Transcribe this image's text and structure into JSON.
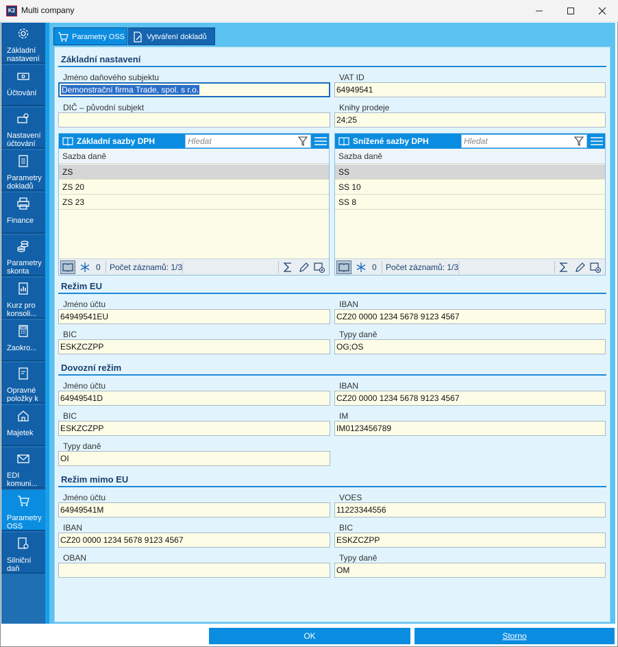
{
  "window": {
    "title": "Multi company",
    "logo_text": "K2"
  },
  "sidebar": {
    "items": [
      {
        "label": "Základní nastavení",
        "icon": "gear-icon"
      },
      {
        "label": "Účtování",
        "icon": "money-icon"
      },
      {
        "label": "Nastavení účtování DPH",
        "icon": "money-settings-icon"
      },
      {
        "label": "Parametry dokladů samovy",
        "icon": "document-icon"
      },
      {
        "label": "Finance",
        "icon": "printer-icon"
      },
      {
        "label": "Parametry skonta",
        "icon": "coins-icon"
      },
      {
        "label": "Kurz pro konsoli...",
        "icon": "chart-document-icon"
      },
      {
        "label": "Zaokro...",
        "icon": "calculator-icon"
      },
      {
        "label": "Opravné položky k pohled",
        "icon": "document-edit-icon"
      },
      {
        "label": "Majetek",
        "icon": "asset-icon"
      },
      {
        "label": "EDI komuni...",
        "icon": "edi-mail-icon"
      },
      {
        "label": "Parametry OSS",
        "icon": "cart-icon"
      },
      {
        "label": "Silniční daň",
        "icon": "document-gear-icon"
      }
    ]
  },
  "tabs": [
    {
      "label": "Parametry OSS",
      "icon": "cart-icon"
    },
    {
      "label": "Vytváření dokladů",
      "icon": "document-create-icon"
    }
  ],
  "basic": {
    "title": "Základní nastavení",
    "tax_subject_label": "Jméno daňového subjektu",
    "tax_subject_value": "Demonstrační firma Trade, spol. s r.o.",
    "vat_id_label": "VAT ID",
    "vat_id_value": "64949541",
    "dic_label": "DIČ – původní subjekt",
    "dic_value": "",
    "sales_books_label": "Knihy prodeje",
    "sales_books_value": "24;25"
  },
  "grid_basic": {
    "title": "Základní sazby DPH",
    "search_placeholder": "Hledat",
    "column": "Sazba daně",
    "rows": [
      "ZS",
      "ZS 20",
      "ZS 23"
    ],
    "zero": "0",
    "count": "Počet záznamů: 1/3"
  },
  "grid_reduced": {
    "title": "Snížené sazby DPH",
    "search_placeholder": "Hledat",
    "column": "Sazba daně",
    "rows": [
      "SS",
      "SS 10",
      "SS 8"
    ],
    "zero": "0",
    "count": "Počet záznamů: 1/3"
  },
  "eu": {
    "title": "Režim EU",
    "account_label": "Jméno účtu",
    "account_value": "64949541EU",
    "iban_label": "IBAN",
    "iban_value": "CZ20 0000 1234 5678 9123 4567",
    "bic_label": "BIC",
    "bic_value": "ESKZCZPP",
    "tax_types_label": "Typy daně",
    "tax_types_value": "OG;OS"
  },
  "import": {
    "title": "Dovozní režim",
    "account_label": "Jméno účtu",
    "account_value": "64949541D",
    "iban_label": "IBAN",
    "iban_value": "CZ20 0000 1234 5678 9123 4567",
    "bic_label": "BIC",
    "bic_value": "ESKZCZPP",
    "im_label": "IM",
    "im_value": "IM0123456789",
    "tax_types_label": "Typy daně",
    "tax_types_value": "OI"
  },
  "non_eu": {
    "title": "Režim mimo EU",
    "account_label": "Jméno účtu",
    "account_value": "64949541M",
    "voes_label": "VOES",
    "voes_value": "11223344556",
    "iban_label": "IBAN",
    "iban_value": "CZ20 0000 1234 5678 9123 4567",
    "bic_label": "BIC",
    "bic_value": "ESKZCZPP",
    "oban_label": "OBAN",
    "oban_value": "",
    "tax_types_label": "Typy daně",
    "tax_types_value": "OM"
  },
  "buttons": {
    "ok": "OK",
    "cancel": "Storno"
  }
}
